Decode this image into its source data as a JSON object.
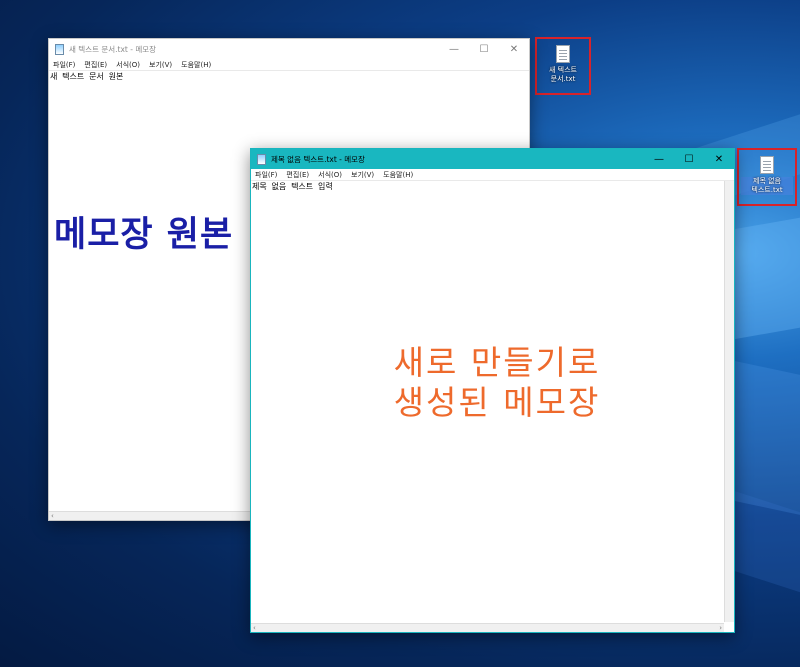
{
  "desktop": {
    "icons": [
      {
        "label": "새 텍스트\n문서.txt",
        "icon": "text-file-icon"
      },
      {
        "label": "제목 없음\n텍스트.txt",
        "icon": "text-file-icon"
      }
    ]
  },
  "windows": [
    {
      "title": "새 텍스트 문서.txt - 메모장",
      "menu": [
        "파일(F)",
        "편집(E)",
        "서식(O)",
        "보기(V)",
        "도움말(H)"
      ],
      "content": "새 텍스트 문서 원본",
      "active": false,
      "titlebar_color": "#ffffff"
    },
    {
      "title": "제목 없음 텍스트.txt - 메모장",
      "menu": [
        "파일(F)",
        "편집(E)",
        "서식(O)",
        "보기(V)",
        "도움말(H)"
      ],
      "content": "제목 없음 텍스트 입력",
      "active": true,
      "titlebar_color": "#19b7c0"
    }
  ],
  "annotations": {
    "original": "메모장 원본",
    "new_line1": "새로 만들기로",
    "new_line2": "생성된 메모장"
  },
  "controls": {
    "minimize": "—",
    "maximize": "☐",
    "close": "✕"
  },
  "colors": {
    "highlight_box": "#d8232a",
    "annotation_blue": "#1a1fa6",
    "annotation_orange": "#ee6a2c"
  }
}
